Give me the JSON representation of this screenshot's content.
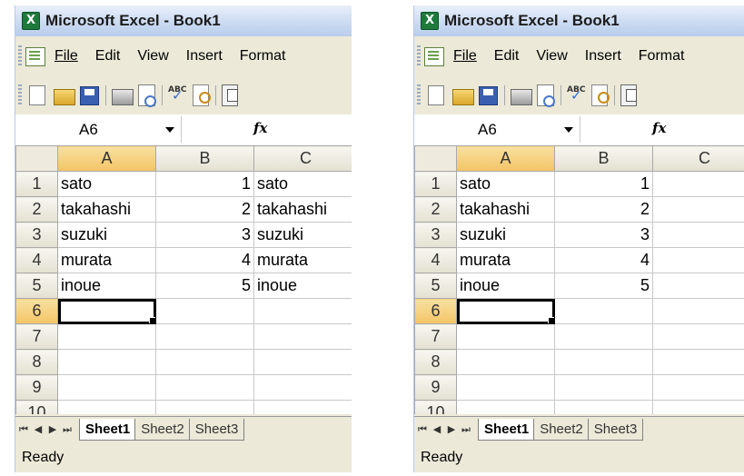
{
  "windows": [
    {
      "title": "Microsoft Excel - Book1",
      "menu": [
        {
          "label": "File"
        },
        {
          "label": "Edit"
        },
        {
          "label": "View"
        },
        {
          "label": "Insert"
        },
        {
          "label": "Format"
        }
      ],
      "namebox": "A6",
      "fx": "fx",
      "columns": [
        "A",
        "B",
        "C"
      ],
      "rows": [
        {
          "num": "1",
          "a": "sato",
          "b": "1",
          "c": "sato"
        },
        {
          "num": "2",
          "a": "takahashi",
          "b": "2",
          "c": "takahashi"
        },
        {
          "num": "3",
          "a": "suzuki",
          "b": "3",
          "c": "suzuki"
        },
        {
          "num": "4",
          "a": "murata",
          "b": "4",
          "c": "murata"
        },
        {
          "num": "5",
          "a": "inoue",
          "b": "5",
          "c": "inoue"
        },
        {
          "num": "6",
          "a": "",
          "b": "",
          "c": ""
        },
        {
          "num": "7",
          "a": "",
          "b": "",
          "c": ""
        },
        {
          "num": "8",
          "a": "",
          "b": "",
          "c": ""
        },
        {
          "num": "9",
          "a": "",
          "b": "",
          "c": ""
        },
        {
          "num": "10",
          "a": "",
          "b": "",
          "c": ""
        }
      ],
      "tabs": [
        "Sheet1",
        "Sheet2",
        "Sheet3"
      ],
      "status": "Ready"
    },
    {
      "title": "Microsoft Excel - Book1",
      "menu": [
        {
          "label": "File"
        },
        {
          "label": "Edit"
        },
        {
          "label": "View"
        },
        {
          "label": "Insert"
        },
        {
          "label": "Format"
        }
      ],
      "namebox": "A6",
      "fx": "fx",
      "columns": [
        "A",
        "B",
        "C"
      ],
      "rows": [
        {
          "num": "1",
          "a": "sato",
          "b": "1",
          "c": ""
        },
        {
          "num": "2",
          "a": "takahashi",
          "b": "2",
          "c": ""
        },
        {
          "num": "3",
          "a": "suzuki",
          "b": "3",
          "c": ""
        },
        {
          "num": "4",
          "a": "murata",
          "b": "4",
          "c": ""
        },
        {
          "num": "5",
          "a": "inoue",
          "b": "5",
          "c": ""
        },
        {
          "num": "6",
          "a": "",
          "b": "",
          "c": ""
        },
        {
          "num": "7",
          "a": "",
          "b": "",
          "c": ""
        },
        {
          "num": "8",
          "a": "",
          "b": "",
          "c": ""
        },
        {
          "num": "9",
          "a": "",
          "b": "",
          "c": ""
        },
        {
          "num": "10",
          "a": "",
          "b": "",
          "c": ""
        }
      ],
      "tabs": [
        "Sheet1",
        "Sheet2",
        "Sheet3"
      ],
      "status": "Ready"
    }
  ],
  "colors": {
    "window_bg": "#ECE9D8",
    "selected_column_header": "#F4C466",
    "grid_line": "#C8C8C8"
  }
}
